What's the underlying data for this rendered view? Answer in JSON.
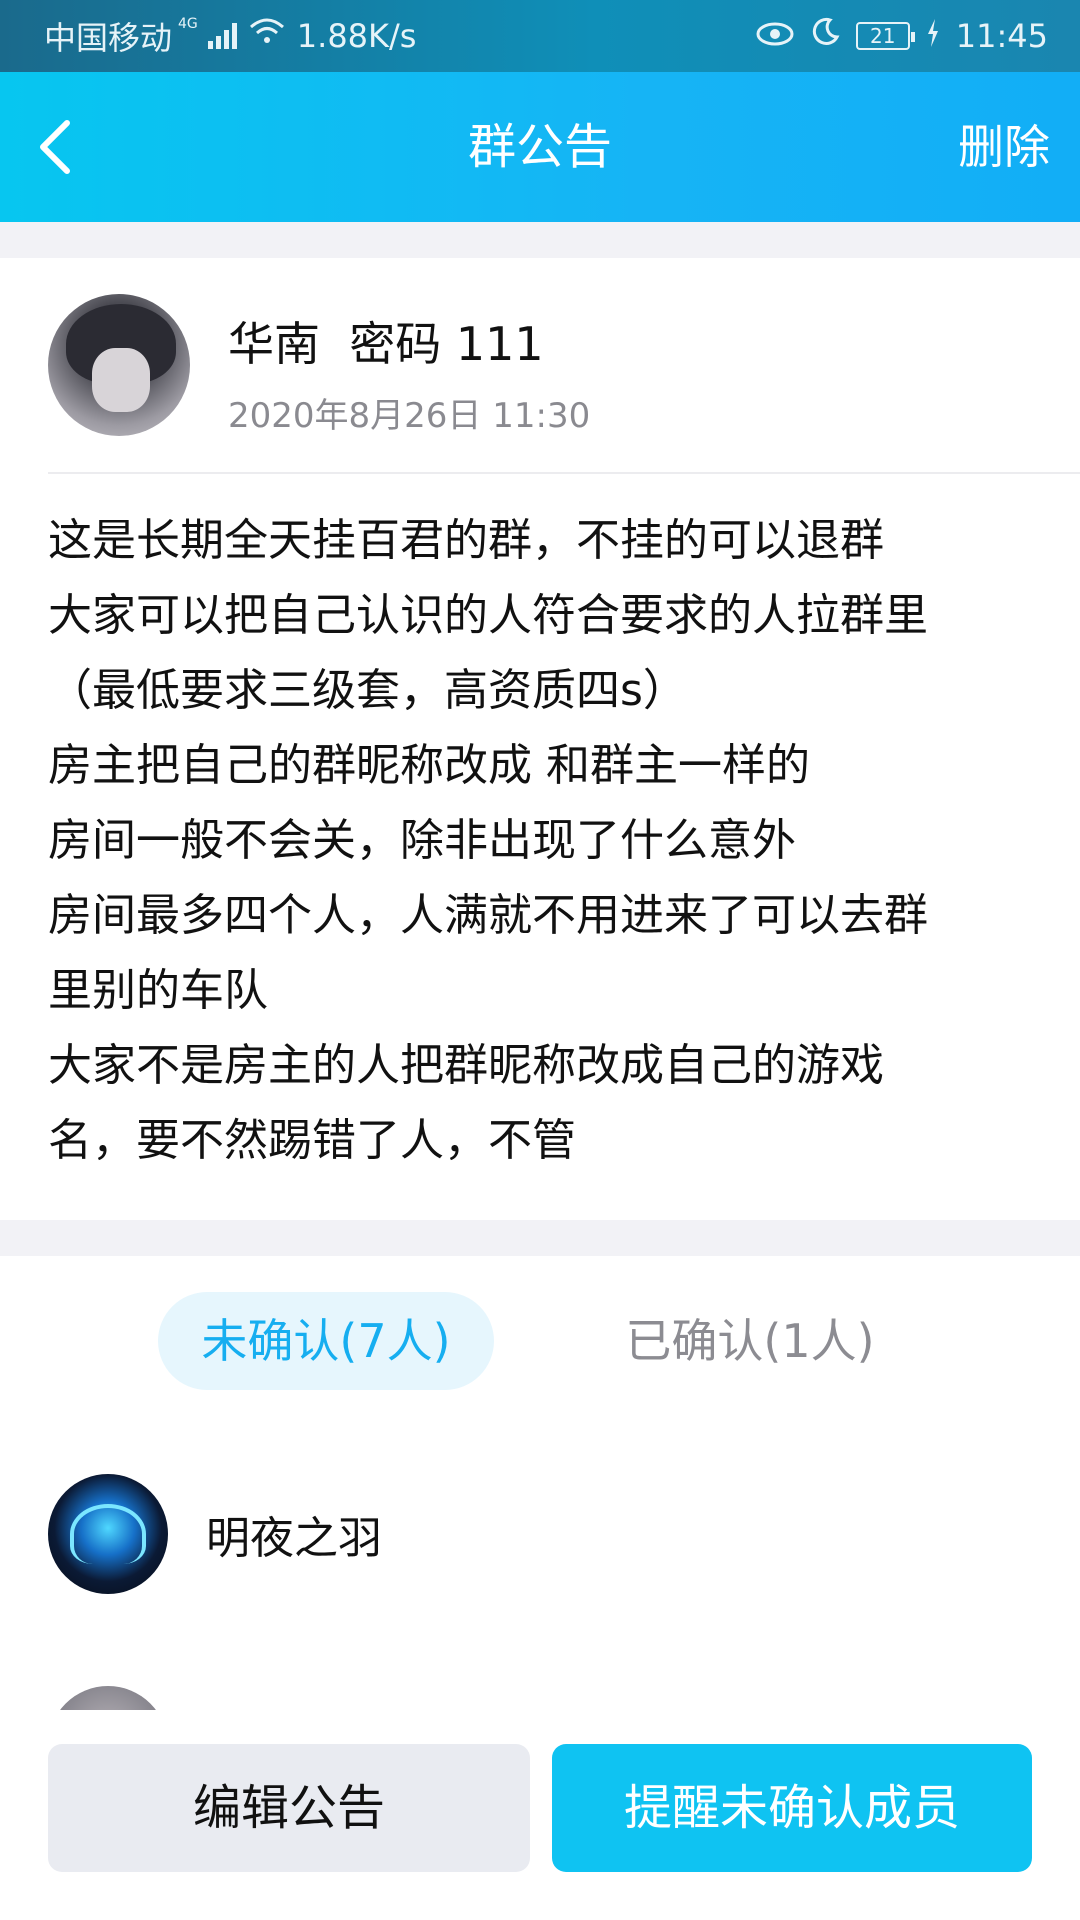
{
  "status_bar": {
    "carrier": "中国移动",
    "network": "4G",
    "speed": "1.88K/s",
    "battery": "21",
    "time": "11:45"
  },
  "header": {
    "title": "群公告",
    "delete_label": "删除"
  },
  "notice": {
    "author": "华南  密码 111",
    "time": "2020年8月26日 11:30",
    "lines": [
      "这是长期全天挂百君的群，不挂的可以退群",
      "大家可以把自己认识的人符合要求的人拉群里",
      "（最低要求三级套，高资质四s）",
      "房主把自己的群昵称改成 和群主一样的",
      "房间一般不会关，除非出现了什么意外",
      "房间最多四个人，人满就不用进来了可以去群",
      "里别的车队",
      "大家不是房主的人把群昵称改成自己的游戏",
      "名，要不然踢错了人，不管"
    ]
  },
  "tabs": {
    "unconfirmed": "未确认(7人)",
    "confirmed": "已确认(1人)"
  },
  "members": [
    {
      "name": "明夜之羽"
    }
  ],
  "actions": {
    "edit": "编辑公告",
    "remind": "提醒未确认成员"
  }
}
